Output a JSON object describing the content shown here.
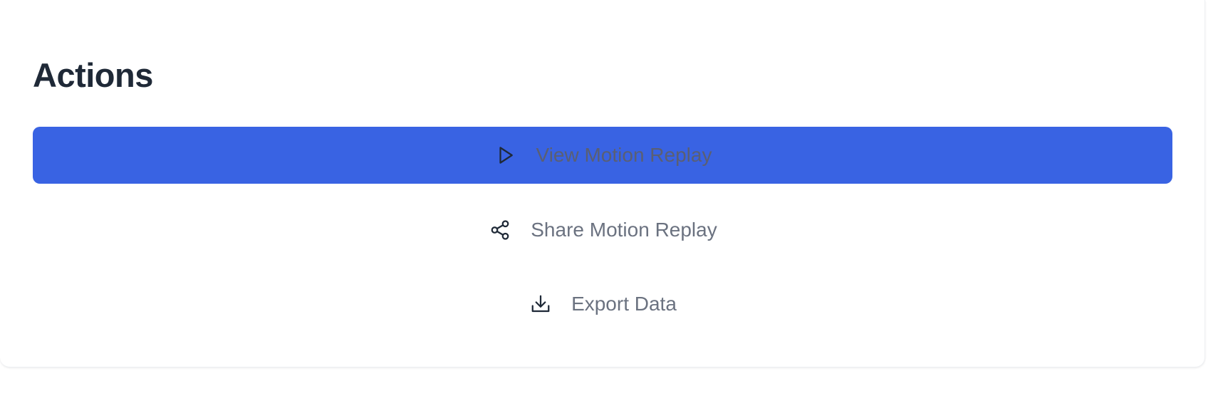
{
  "card": {
    "title": "Actions"
  },
  "actions": [
    {
      "label": "View Motion Replay",
      "icon": "play-icon",
      "style": "primary"
    },
    {
      "label": "Share Motion Replay",
      "icon": "share-icon",
      "style": "ghost"
    },
    {
      "label": "Export Data",
      "icon": "download-icon",
      "style": "ghost"
    }
  ],
  "colors": {
    "primary_button": "#3963e3",
    "title_text": "#1f2937",
    "ghost_text": "#6b7280",
    "icon_stroke": "#1f2937"
  }
}
